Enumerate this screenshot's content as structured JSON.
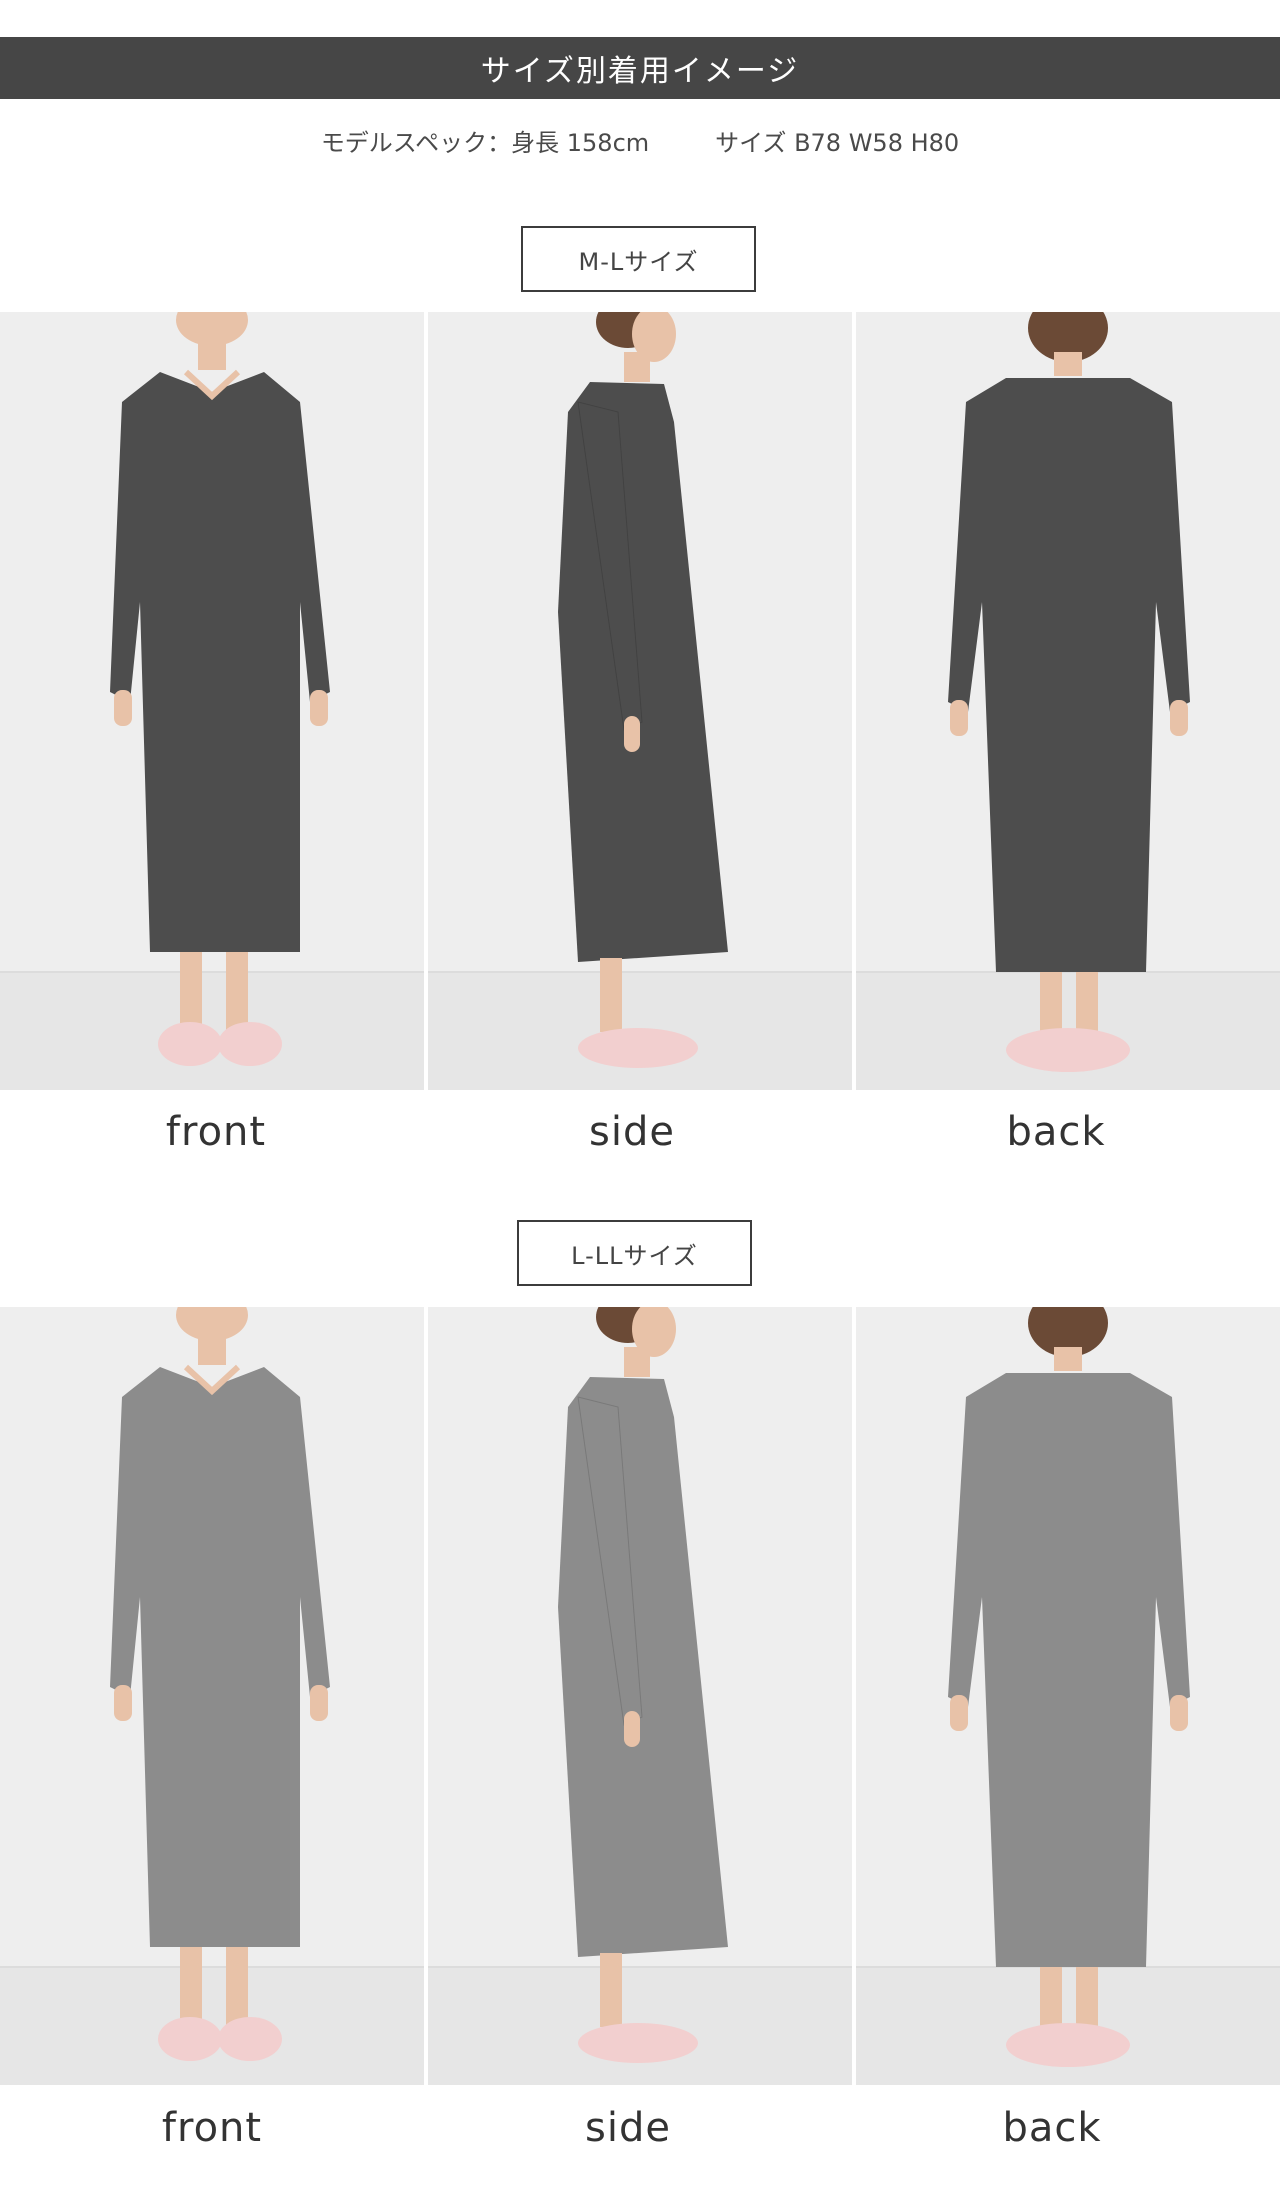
{
  "header": {
    "title": "サイズ別着用イメージ"
  },
  "model_spec": {
    "height": "モデルスペック：身長 158cm",
    "measurements": "サイズ B78 W58 H80"
  },
  "sections": [
    {
      "size_label": "M-Lサイズ",
      "dress_color": "#4d4d4d",
      "photos": [
        {
          "caption": "front"
        },
        {
          "caption": "side"
        },
        {
          "caption": "back"
        }
      ]
    },
    {
      "size_label": "L-LLサイズ",
      "dress_color": "#8c8c8c",
      "photos": [
        {
          "caption": "front"
        },
        {
          "caption": "side"
        },
        {
          "caption": "back"
        }
      ]
    }
  ],
  "colors": {
    "header_bg": "#464646",
    "photo_bg": "#eeeeee",
    "floor": "#e6e6e6",
    "slipper": "#f2cfcf",
    "skin": "#e8c2a8",
    "hair": "#6b4a36"
  }
}
